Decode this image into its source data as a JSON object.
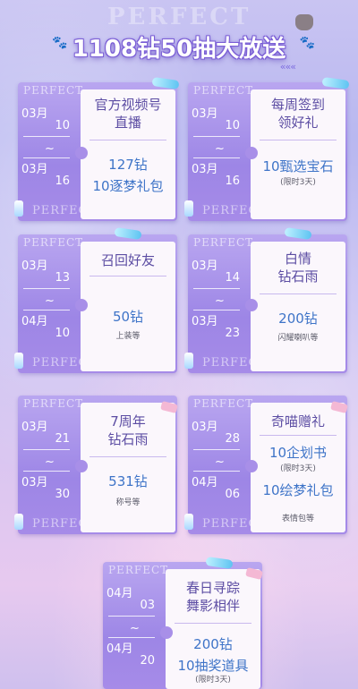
{
  "header": {
    "watermark": "PERFECT",
    "title": "1108钻50抽大放送",
    "arrows": "«««",
    "paw_left": "🐾",
    "paw_right": "🐾"
  },
  "card_watermark_top": "PERFECT",
  "card_watermark_bottom": "PERFECT",
  "cards": [
    {
      "start_m": "03月",
      "start_d": "10",
      "end_m": "03月",
      "end_d": "16",
      "title": [
        "官方视频号",
        "直播"
      ],
      "rewards": [
        "127钻",
        "10逐梦礼包"
      ],
      "notes": []
    },
    {
      "start_m": "03月",
      "start_d": "10",
      "end_m": "03月",
      "end_d": "16",
      "title": [
        "每周签到",
        "领好礼"
      ],
      "rewards": [
        "10甄选宝石"
      ],
      "notes": [
        "(限时3天)"
      ]
    },
    {
      "start_m": "03月",
      "start_d": "13",
      "end_m": "04月",
      "end_d": "10",
      "title": [
        "召回好友"
      ],
      "rewards": [
        "50钻"
      ],
      "notes": [
        "上装等"
      ]
    },
    {
      "start_m": "03月",
      "start_d": "14",
      "end_m": "03月",
      "end_d": "23",
      "title": [
        "白情",
        "钻石雨"
      ],
      "rewards": [
        "200钻"
      ],
      "notes": [
        "闪耀喇叭等"
      ]
    },
    {
      "start_m": "03月",
      "start_d": "21",
      "end_m": "03月",
      "end_d": "30",
      "title": [
        "7周年",
        "钻石雨"
      ],
      "rewards": [
        "531钻"
      ],
      "notes": [
        "称号等"
      ]
    },
    {
      "start_m": "03月",
      "start_d": "28",
      "end_m": "04月",
      "end_d": "06",
      "title": [
        "奇喵赠礼"
      ],
      "rewards": [
        "10企划书",
        "10绘梦礼包"
      ],
      "notes": [
        "(限时3天)",
        "表情包等"
      ]
    },
    {
      "start_m": "04月",
      "start_d": "03",
      "end_m": "04月",
      "end_d": "20",
      "title": [
        "春日寻踪",
        "舞影相伴"
      ],
      "rewards": [
        "200钻",
        "10抽奖道具"
      ],
      "notes": [
        "(限时3天)"
      ]
    }
  ]
}
